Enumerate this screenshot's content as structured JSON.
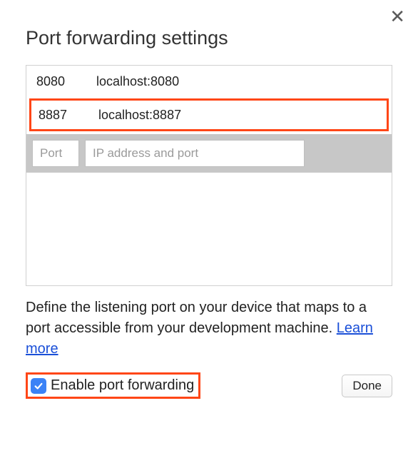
{
  "title": "Port forwarding settings",
  "rows": [
    {
      "port": "8080",
      "address": "localhost:8080",
      "highlighted": false
    },
    {
      "port": "8887",
      "address": "localhost:8887",
      "highlighted": true
    }
  ],
  "input": {
    "port_placeholder": "Port",
    "address_placeholder": "IP address and port"
  },
  "description": "Define the listening port on your device that maps to a port accessible from your development machine. ",
  "learn_more": "Learn more",
  "checkbox": {
    "checked": true,
    "label": "Enable port forwarding"
  },
  "done_label": "Done"
}
